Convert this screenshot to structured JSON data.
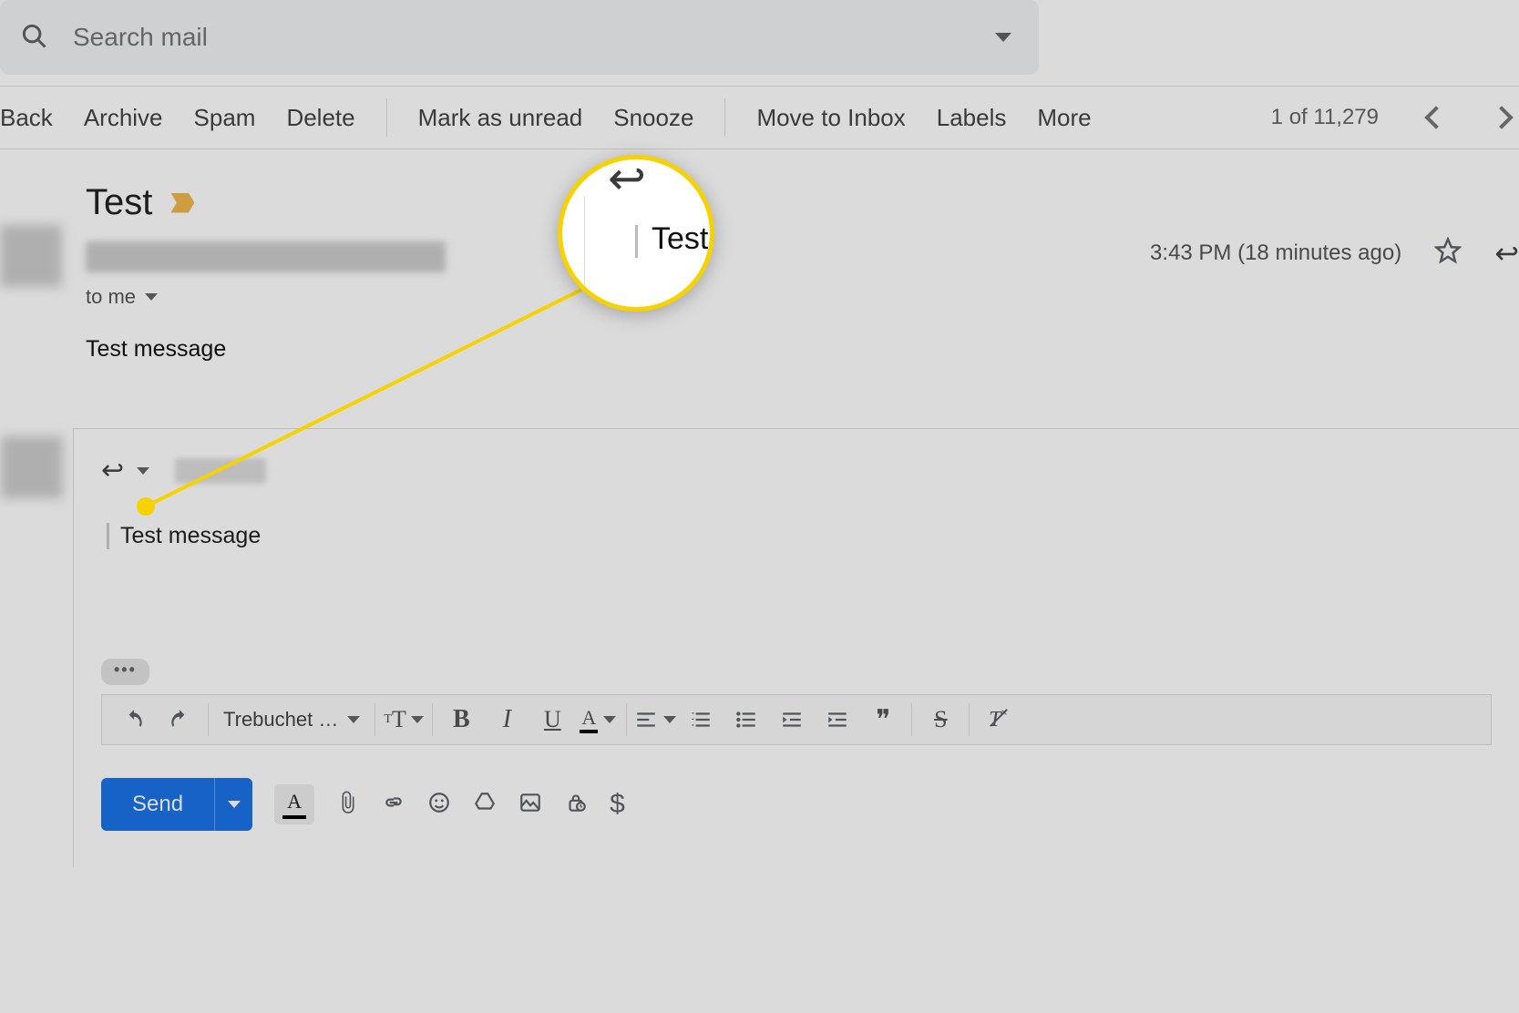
{
  "search": {
    "placeholder": "Search mail"
  },
  "toolbar": {
    "back": "Back",
    "archive": "Archive",
    "spam": "Spam",
    "delete": "Delete",
    "mark_unread": "Mark as unread",
    "snooze": "Snooze",
    "move_inbox": "Move to Inbox",
    "labels": "Labels",
    "more": "More",
    "counter": "1 of 11,279"
  },
  "email": {
    "subject": "Test",
    "to_line": "to me",
    "timestamp": "3:43 PM (18 minutes ago)",
    "body": "Test message"
  },
  "reply": {
    "quoted_text": "Test message"
  },
  "format": {
    "font": "Trebuchet …"
  },
  "send": {
    "label": "Send"
  },
  "magnifier": {
    "text": "Test"
  }
}
